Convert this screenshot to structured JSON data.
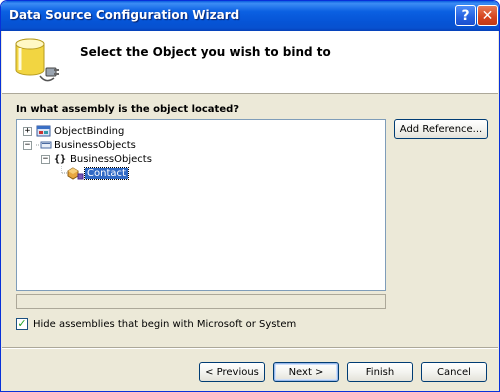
{
  "window": {
    "title": "Data Source Configuration Wizard",
    "help_glyph": "?",
    "close_glyph": "✕"
  },
  "header": {
    "title": "Select the Object you wish to bind to",
    "icon": "database-plug-icon"
  },
  "assembly": {
    "question": "In what assembly is the object located?",
    "tree": [
      {
        "label": "ObjectBinding",
        "expander": "+",
        "icon": "project-icon",
        "level": 0
      },
      {
        "label": "BusinessObjects",
        "expander": "−",
        "icon": "assembly-icon",
        "level": 0
      },
      {
        "label": "BusinessObjects",
        "expander": "−",
        "icon": "namespace-icon",
        "level": 1,
        "glyph": "{}"
      },
      {
        "label": "Contact",
        "expander": "",
        "icon": "class-icon",
        "level": 2,
        "selected": true
      }
    ],
    "add_reference": "Add Reference..."
  },
  "options": {
    "hide_assemblies_label": "Hide assemblies that begin with Microsoft or System",
    "hide_assemblies_checked": true
  },
  "buttons": {
    "previous": "< Previous",
    "next": "Next >",
    "finish": "Finish",
    "cancel": "Cancel"
  },
  "colors": {
    "titlebar": "#0654d6",
    "selection": "#316ac5",
    "face": "#ece9d8"
  }
}
